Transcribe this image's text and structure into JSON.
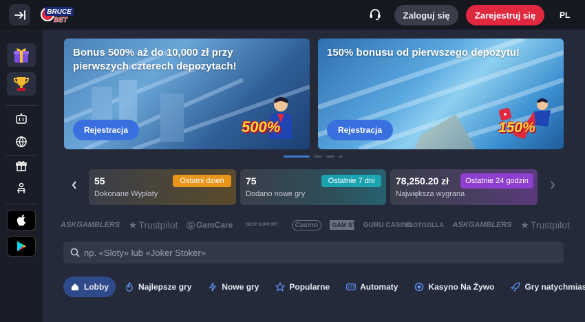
{
  "header": {
    "logo_text": "BRUCE BET",
    "login_label": "Zaloguj się",
    "register_label": "Zarejestruj się",
    "language": "PL",
    "icons": [
      "menu-collapse-icon",
      "support-headset-icon"
    ]
  },
  "sidebar": {
    "items": [
      {
        "name": "gift",
        "icon": "gift-icon"
      },
      {
        "name": "trophy",
        "icon": "trophy-icon"
      },
      {
        "name": "slots",
        "icon": "slot-machine-icon"
      },
      {
        "name": "sport",
        "icon": "ball-icon"
      },
      {
        "name": "bonus",
        "icon": "present-icon"
      },
      {
        "name": "live",
        "icon": "dealer-icon"
      },
      {
        "name": "app-store",
        "icon": "apple-icon"
      },
      {
        "name": "google-play",
        "icon": "google-play-icon"
      }
    ]
  },
  "banners": [
    {
      "title": "Bonus 500% aż do 10,000 zł przy pierwszych czterech depozytach!",
      "button": "Rejestracja",
      "badge": "500%"
    },
    {
      "title": "150% bonusu od pierwszego depozytu!",
      "button": "Rejestracja",
      "badge": "150%"
    }
  ],
  "carousel": {
    "active_index": 0,
    "count": 4
  },
  "stats": [
    {
      "value": "55",
      "label": "Dokonane Wypłaty",
      "badge": "Ostatni dzień",
      "color": "#e8951a"
    },
    {
      "value": "75",
      "label": "Dodano nowe gry",
      "badge": "Ostatnie 7 dni",
      "color": "#1ba3b0"
    },
    {
      "value": "78,250.20 zł",
      "label": "Największa wygrana",
      "badge": "Ostatnie 24 godzin",
      "color": "#8e3fd0"
    }
  ],
  "partners": [
    "ASKGAMBLERS",
    "Trustpilot",
    "GamCare",
    "BEST SUPPORT",
    "Casino",
    "GAM STOP",
    "GURU CASINO",
    "SLOTOZILLA",
    "ASKGAMBLERS",
    "Trustpilot"
  ],
  "search": {
    "placeholder": "np. «Sloty» lub «Joker Stoker»"
  },
  "tabs": [
    {
      "label": "Lobby",
      "icon": "home-icon",
      "active": true
    },
    {
      "label": "Najlepsze gry",
      "icon": "flame-icon"
    },
    {
      "label": "Nowe gry",
      "icon": "lightning-icon"
    },
    {
      "label": "Popularne",
      "icon": "star-icon"
    },
    {
      "label": "Automaty",
      "icon": "slot-777-icon"
    },
    {
      "label": "Kasyno Na Żywo",
      "icon": "live-dot-icon"
    },
    {
      "label": "Gry natychmiastowe",
      "icon": "rocket-icon"
    }
  ],
  "colors": {
    "accent_red": "#e0283f",
    "accent_blue": "#3a6fe0",
    "background": "#252a3b",
    "topbar": "#16181f"
  }
}
